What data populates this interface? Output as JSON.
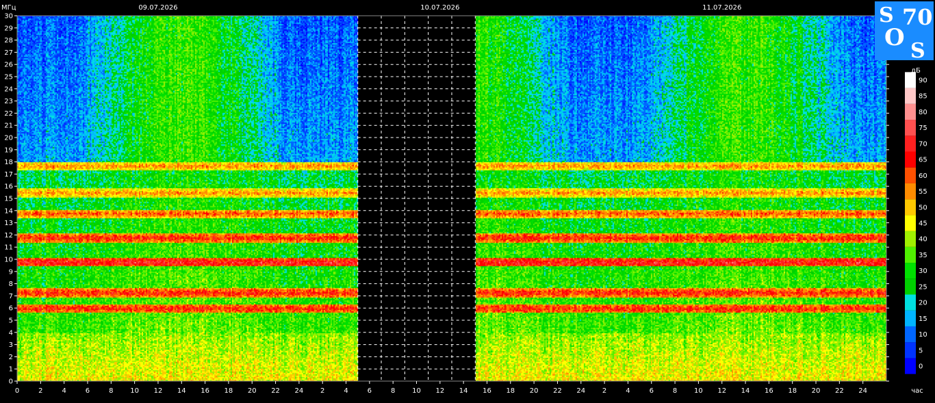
{
  "chart_data": {
    "type": "heatmap",
    "ylabel": "МГц",
    "xlabel": "час",
    "colorbar_label": "дБ",
    "dates": [
      "09.07.2026",
      "10.07.2026",
      "11.07.2026"
    ],
    "ylim": [
      0,
      30
    ],
    "y_ticks": [
      "0",
      "1",
      "2",
      "3",
      "4",
      "5",
      "6",
      "7",
      "8",
      "9",
      "10",
      "11",
      "12",
      "13",
      "14",
      "15",
      "16",
      "17",
      "18",
      "19",
      "20",
      "21",
      "22",
      "23",
      "24",
      "25",
      "26",
      "27",
      "28",
      "29",
      "30"
    ],
    "x_ticks": [
      "0",
      "2",
      "4",
      "6",
      "8",
      "10",
      "12",
      "14",
      "16",
      "18",
      "20",
      "22",
      "24",
      "2",
      "4",
      "6",
      "8",
      "10",
      "12",
      "14",
      "16",
      "18",
      "20",
      "22",
      "24",
      "2",
      "4",
      "6",
      "8",
      "10",
      "12",
      "14",
      "16",
      "18",
      "20",
      "22",
      "24"
    ],
    "x_hours_total": 74,
    "data_gap_hours": [
      29,
      39
    ],
    "colorbar": {
      "ticks": [
        "0",
        "5",
        "10",
        "15",
        "20",
        "25",
        "30",
        "35",
        "40",
        "45",
        "50",
        "55",
        "60",
        "65",
        "70",
        "75",
        "80",
        "85",
        "90"
      ],
      "colors": [
        "#0000ff",
        "#0033ff",
        "#0066ff",
        "#00b4ff",
        "#00e0e0",
        "#00d000",
        "#00e000",
        "#50f000",
        "#a0f000",
        "#ffff00",
        "#ffc800",
        "#ff8c00",
        "#ff5000",
        "#ff0000",
        "#ff2020",
        "#ff5050",
        "#ff9090",
        "#ffc8c8",
        "#ffffff"
      ]
    },
    "bands_mhz": [
      {
        "freq": 0.5,
        "level": 45
      },
      {
        "freq": 1.2,
        "level": 45
      },
      {
        "freq": 2.0,
        "level": 40
      },
      {
        "freq": 6.0,
        "level": 65
      },
      {
        "freq": 7.3,
        "level": 65
      },
      {
        "freq": 9.8,
        "level": 70
      },
      {
        "freq": 11.8,
        "level": 65
      },
      {
        "freq": 13.8,
        "level": 60
      },
      {
        "freq": 15.5,
        "level": 55
      },
      {
        "freq": 17.7,
        "level": 55
      }
    ],
    "logo": {
      "letters": [
        "S",
        "O",
        "S"
      ],
      "number": "70"
    }
  }
}
